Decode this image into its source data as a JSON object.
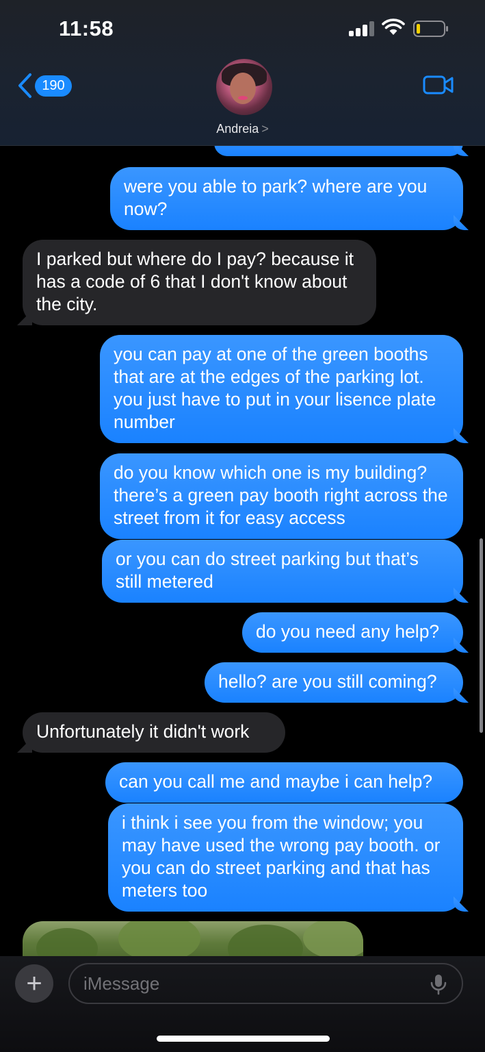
{
  "status_bar": {
    "time": "11:58"
  },
  "header": {
    "back_count": "190",
    "contact_name": "Andreia",
    "name_chevron": ">"
  },
  "messages": [
    {
      "direction": "outgoing",
      "text": "were you able to park? where are you now?"
    },
    {
      "direction": "incoming",
      "text": "I parked but where do I pay? because it has a code of 6 that I don't know about the city."
    },
    {
      "direction": "outgoing",
      "text": "you can pay at one of the green booths that are at the edges of the parking lot. you just have to put in your lisence plate number"
    },
    {
      "direction": "outgoing",
      "text": "do you know which one is my building? there’s a green pay booth right across the street from it for easy access"
    },
    {
      "direction": "outgoing",
      "text": "or you can do street parking but that’s still metered"
    },
    {
      "direction": "outgoing",
      "text": "do you need any help?"
    },
    {
      "direction": "outgoing",
      "text": "hello? are you still coming?"
    },
    {
      "direction": "incoming",
      "text": "Unfortunately it didn't work"
    },
    {
      "direction": "outgoing",
      "text": "can you call me and maybe i can help?"
    },
    {
      "direction": "outgoing",
      "text": "i think i see you from the window; you may have used the wrong pay booth. or you can do street parking and that has meters too"
    }
  ],
  "input": {
    "placeholder": "iMessage",
    "plus_label": "+"
  },
  "icons": {
    "back": "chevron-left-icon",
    "video": "video-camera-icon",
    "mic": "microphone-icon",
    "signal": "cellular-signal-icon",
    "wifi": "wifi-icon",
    "battery": "battery-low-icon"
  },
  "colors": {
    "accent": "#1a82ff",
    "incoming_bubble": "#262629",
    "battery_low": "#f5d000"
  }
}
